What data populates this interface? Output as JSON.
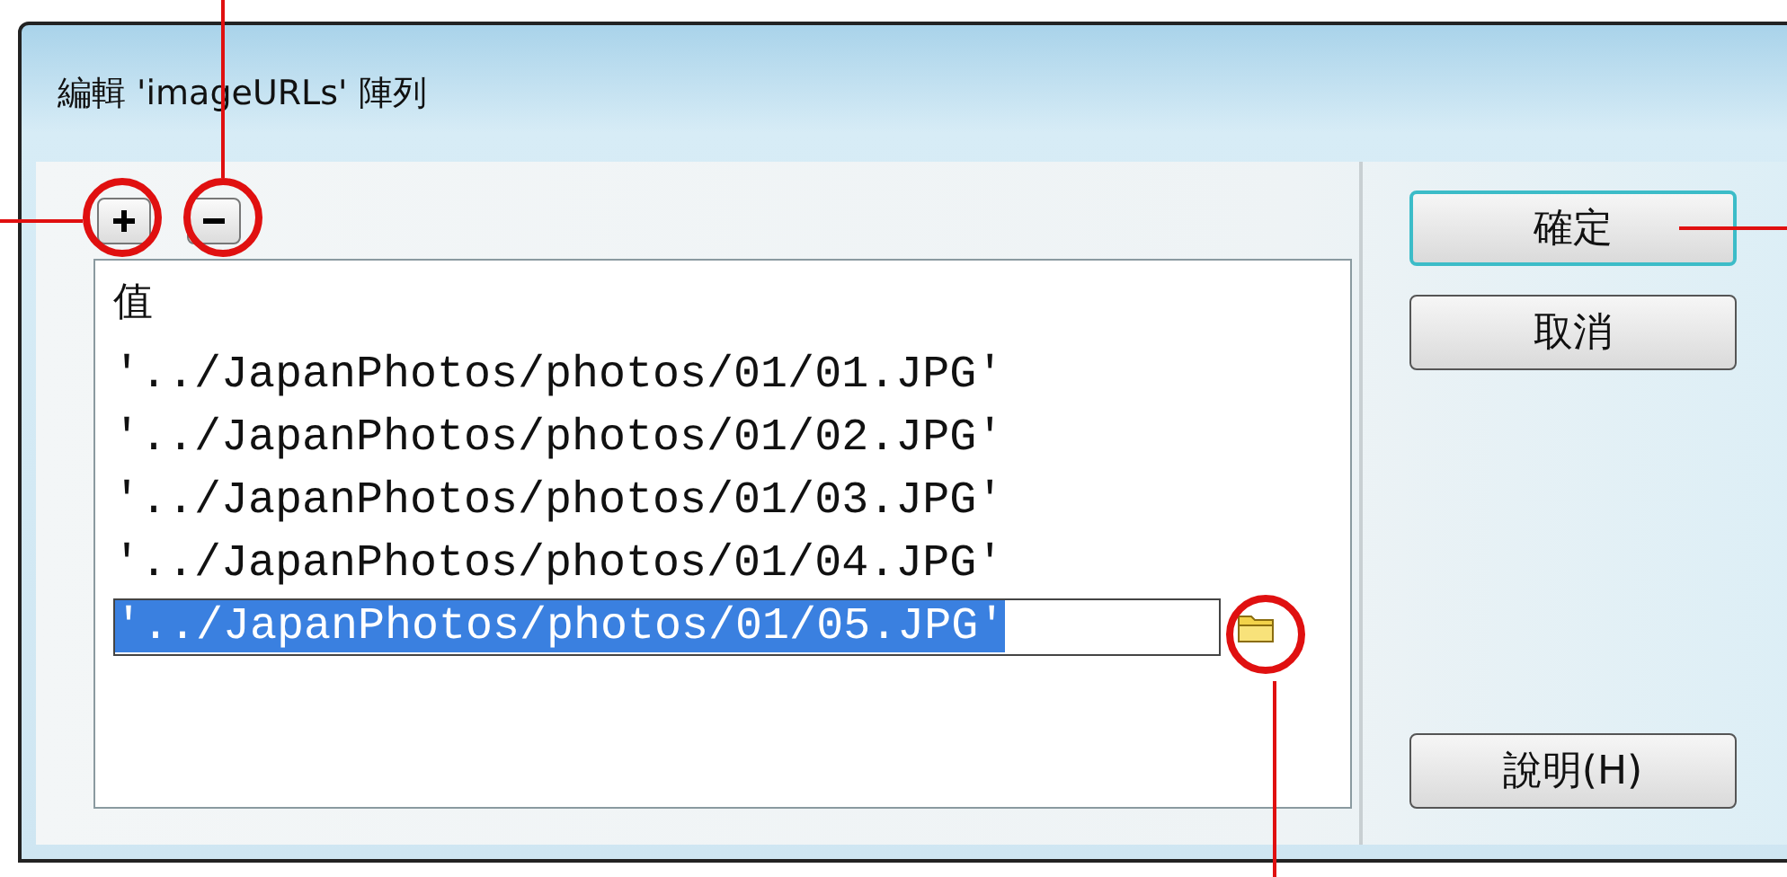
{
  "window": {
    "title": "編輯 'imageURLs' 陣列"
  },
  "toolbar": [
    {
      "kind": "add"
    },
    {
      "kind": "remove"
    }
  ],
  "list": {
    "header": "值",
    "rows": [
      {
        "value": "'../JapanPhotos/photos/01/01.JPG'",
        "selected": false
      },
      {
        "value": "'../JapanPhotos/photos/01/02.JPG'",
        "selected": false
      },
      {
        "value": "'../JapanPhotos/photos/01/03.JPG'",
        "selected": false
      },
      {
        "value": "'../JapanPhotos/photos/01/04.JPG'",
        "selected": false
      },
      {
        "value": "'../JapanPhotos/photos/01/05.JPG'",
        "selected": true
      }
    ]
  },
  "buttons": [
    {
      "label": "確定",
      "default": true
    },
    {
      "label": "取消",
      "default": false
    }
  ],
  "help_button": {
    "label": "說明(H)"
  }
}
